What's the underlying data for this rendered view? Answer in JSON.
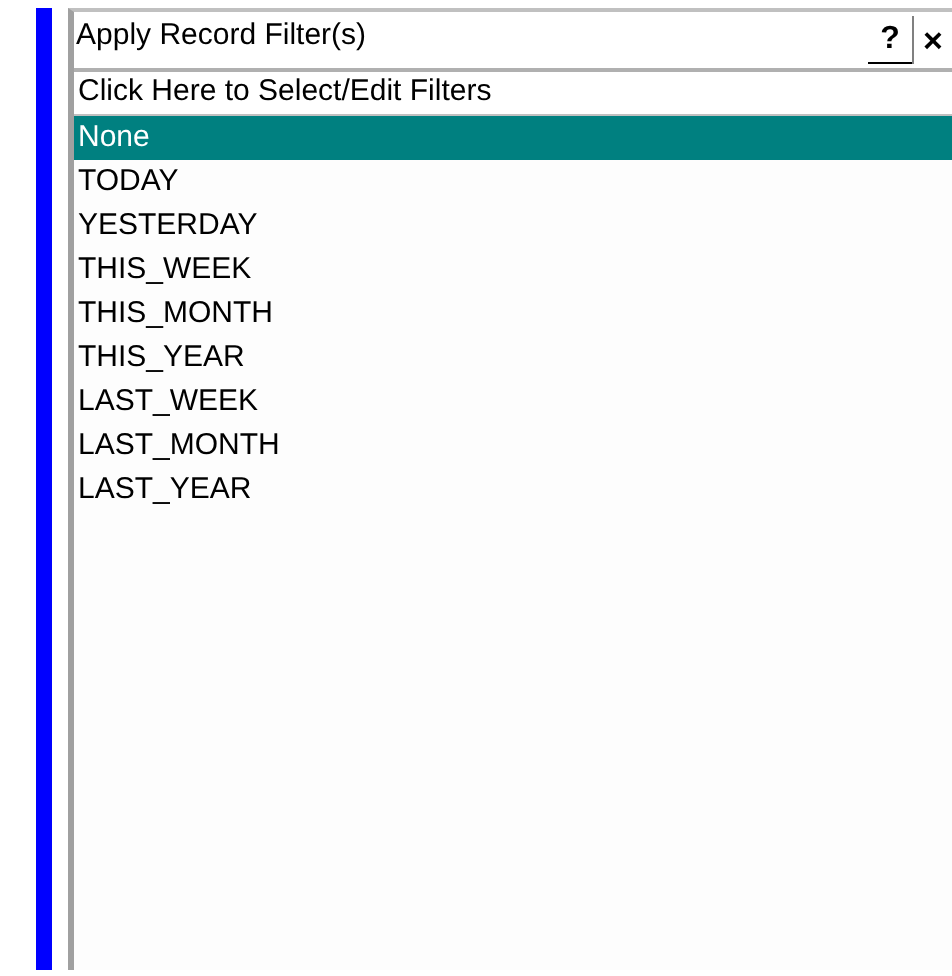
{
  "window": {
    "title": "Apply Record Filter(s)",
    "help_button": "?",
    "close_button": "×"
  },
  "header": "Click Here to Select/Edit Filters",
  "filters": [
    {
      "label": "None",
      "selected": true
    },
    {
      "label": "TODAY",
      "selected": false
    },
    {
      "label": "YESTERDAY",
      "selected": false
    },
    {
      "label": "THIS_WEEK",
      "selected": false
    },
    {
      "label": "THIS_MONTH",
      "selected": false
    },
    {
      "label": "THIS_YEAR",
      "selected": false
    },
    {
      "label": "LAST_WEEK",
      "selected": false
    },
    {
      "label": "LAST_MONTH",
      "selected": false
    },
    {
      "label": "LAST_YEAR",
      "selected": false
    }
  ]
}
